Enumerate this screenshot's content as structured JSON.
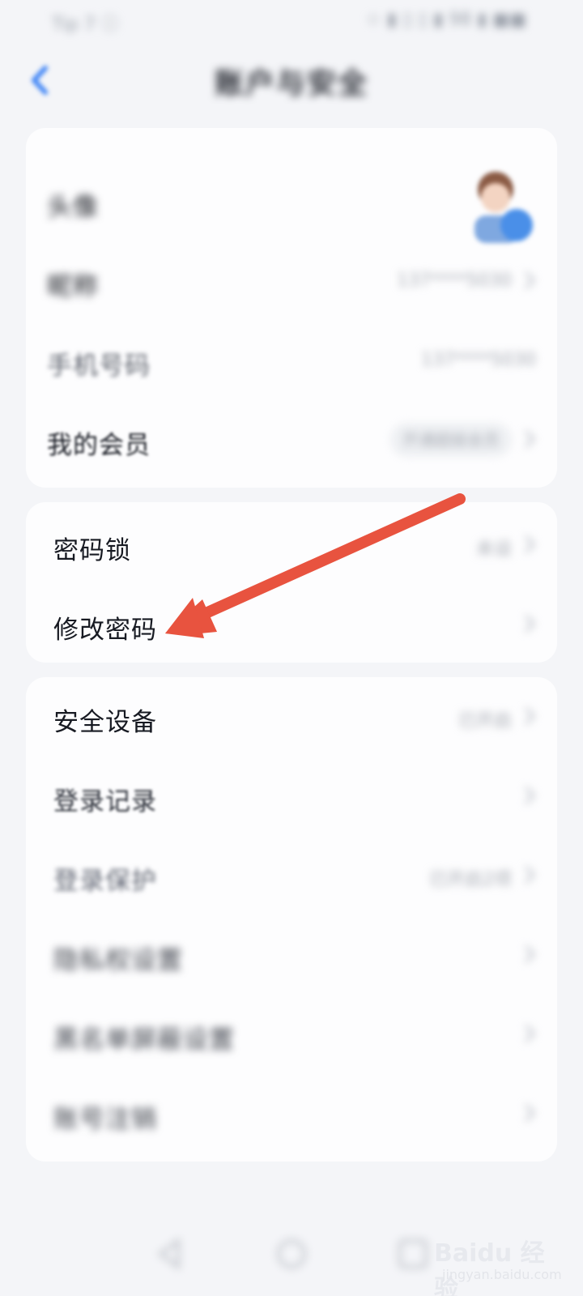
{
  "status_bar": {
    "left_text": "Tip 7 ⓘ",
    "right_text": "☆ ▮ ▯ ▯ ▮ 98 ▮ ■■"
  },
  "header": {
    "title": "账户与安全"
  },
  "account_card": {
    "avatar_label": "头像",
    "nickname_label": "昵称",
    "nickname_value": "137****5030",
    "phone_label": "手机号码",
    "phone_value": "137****5030",
    "membership_label": "我的会员",
    "membership_value": "开通超级会员"
  },
  "password_card": {
    "lock_label": "密码锁",
    "lock_value": "未设",
    "change_label": "修改密码"
  },
  "security_card": {
    "devices_label": "安全设备",
    "devices_value": "已开启",
    "login_record_label": "登录记录",
    "login_protect_label": "登录保护",
    "login_protect_value": "已开启2项",
    "privacy_label": "隐私权设置",
    "blacklist_label": "黑名单屏蔽设置",
    "cancel_label": "账号注销"
  },
  "watermark": {
    "brand": "Baidu 经验",
    "site": "jingyan.baidu.com"
  },
  "colors": {
    "arrow": "#e8533f",
    "back_accent": "#3b82f6",
    "card_bg": "#fdfdfe",
    "page_bg": "#f4f5f8"
  },
  "icons": [
    "back-icon",
    "chevron-right-icon",
    "nav-back-icon",
    "nav-home-icon",
    "nav-recent-icon"
  ]
}
